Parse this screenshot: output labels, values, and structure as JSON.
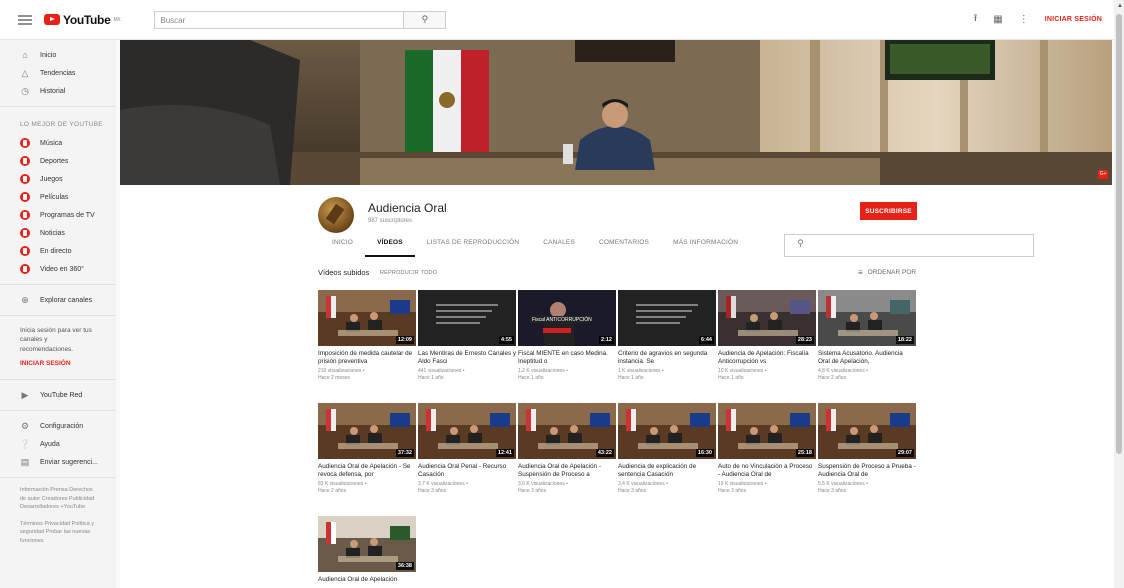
{
  "topbar": {
    "logo_text": "YouTube",
    "logo_sup": "MX",
    "search_placeholder": "Buscar",
    "signin": "INICIAR SESIÓN"
  },
  "sidebar": {
    "main": [
      {
        "label": "Inicio",
        "icon": "home-icon"
      },
      {
        "label": "Tendencias",
        "icon": "flame-icon"
      },
      {
        "label": "Historial",
        "icon": "history-icon"
      }
    ],
    "best_heading": "LO MEJOR DE YOUTUBE",
    "best": [
      {
        "label": "Música"
      },
      {
        "label": "Deportes"
      },
      {
        "label": "Juegos"
      },
      {
        "label": "Películas"
      },
      {
        "label": "Programas de TV"
      },
      {
        "label": "Noticias"
      },
      {
        "label": "En directo"
      },
      {
        "label": "Video en 360°"
      }
    ],
    "explore": "Explorar canales",
    "signin_hint": "Inicia sesión para ver tus canales y recomendaciones.",
    "signin_link": "INICIAR SESIÓN",
    "more": [
      {
        "label": "YouTube Red",
        "icon": "youtube-red-icon"
      },
      {
        "label": "Configuración",
        "icon": "gear-icon"
      },
      {
        "label": "Ayuda",
        "icon": "help-icon"
      },
      {
        "label": "Enviar sugerenci...",
        "icon": "feedback-icon"
      }
    ],
    "footer1": "Información  Prensa  Derechos de autor  Creadores  Publicidad  Desarrolladores  +YouTube",
    "footer2": "Términos  Privacidad  Política y seguridad  Probar las nuevas funciones"
  },
  "channel": {
    "name": "Audiencia Oral",
    "subscribers": "987 suscriptores",
    "subscribe": "SUSCRIBIRSE",
    "tabs": [
      "INICIO",
      "VÍDEOS",
      "LISTAS DE REPRODUCCIÓN",
      "CANALES",
      "COMENTARIOS",
      "MÁS INFORMACIÓN"
    ],
    "active_tab": "VÍDEOS"
  },
  "videos_section": {
    "title": "Vídeos subidos",
    "play_all": "REPRODUCIR TODO",
    "sort": "ORDENAR POR"
  },
  "videos": [
    {
      "title": "Imposición de medida cautelar de prisión preventiva",
      "views": "210 visualizaciones •",
      "age": "Hace 2 meses",
      "duration": "12:09",
      "style": "courtroom"
    },
    {
      "title": "Las Mentiras de Ernesto Canales y Aldo Fasci",
      "views": "441 visualizaciones •",
      "age": "Hace 1 año",
      "duration": "4:55",
      "style": "dark-text"
    },
    {
      "title": "Fiscal MIENTE en caso Medina. Ineptitud o",
      "views": "1,2 K visualizaciones •",
      "age": "Hace 1 año",
      "duration": "2:12",
      "style": "speaker"
    },
    {
      "title": "Criterio de agravios en segunda instancia. Se",
      "views": "1 K visualizaciones •",
      "age": "Hace 1 año",
      "duration": "6:44",
      "style": "dark-text"
    },
    {
      "title": "Audiencia de Apelación: Fiscalía Anticorrupción vs",
      "views": "10 K visualizaciones •",
      "age": "Hace 1 año",
      "duration": "28:23",
      "style": "panel"
    },
    {
      "title": "Sistema Acusatorio. Audiencia Oral de Apelación,",
      "views": "4,8 K visualizaciones •",
      "age": "Hace 2 años",
      "duration": "18:22",
      "style": "hall"
    },
    {
      "title": "Audiencia Oral de Apelación - Se revoca defensa, por",
      "views": "83 K visualizaciones •",
      "age": "Hace 2 años",
      "duration": "37:32",
      "style": "courtroom"
    },
    {
      "title": "Audiencia Oral Penal - Recurso Casación",
      "views": "3,7 K visualizaciones •",
      "age": "Hace 3 años",
      "duration": "12:41",
      "style": "courtroom"
    },
    {
      "title": "Audiencia Oral de Apelación - Suspensión de Proceso a",
      "views": "3,6 K visualizaciones •",
      "age": "Hace 3 años",
      "duration": "43:22",
      "style": "courtroom"
    },
    {
      "title": "Audiencia de explicación de sentencia Casación",
      "views": "3,4 K visualizaciones •",
      "age": "Hace 3 años",
      "duration": "16:30",
      "style": "courtroom"
    },
    {
      "title": "Auto de no Vinculación a Proceso - Audiencia Oral de",
      "views": "19 K visualizaciones •",
      "age": "Hace 3 años",
      "duration": "25:18",
      "style": "courtroom"
    },
    {
      "title": "Suspensión de Proceso a Prueba - Audiencia Oral de",
      "views": "5,5 K visualizaciones •",
      "age": "Hace 3 años",
      "duration": "29:07",
      "style": "courtroom"
    },
    {
      "title": "Audiencia Oral de Apelación",
      "views": "",
      "age": "",
      "duration": "36:38",
      "style": "courtroom-light"
    }
  ]
}
